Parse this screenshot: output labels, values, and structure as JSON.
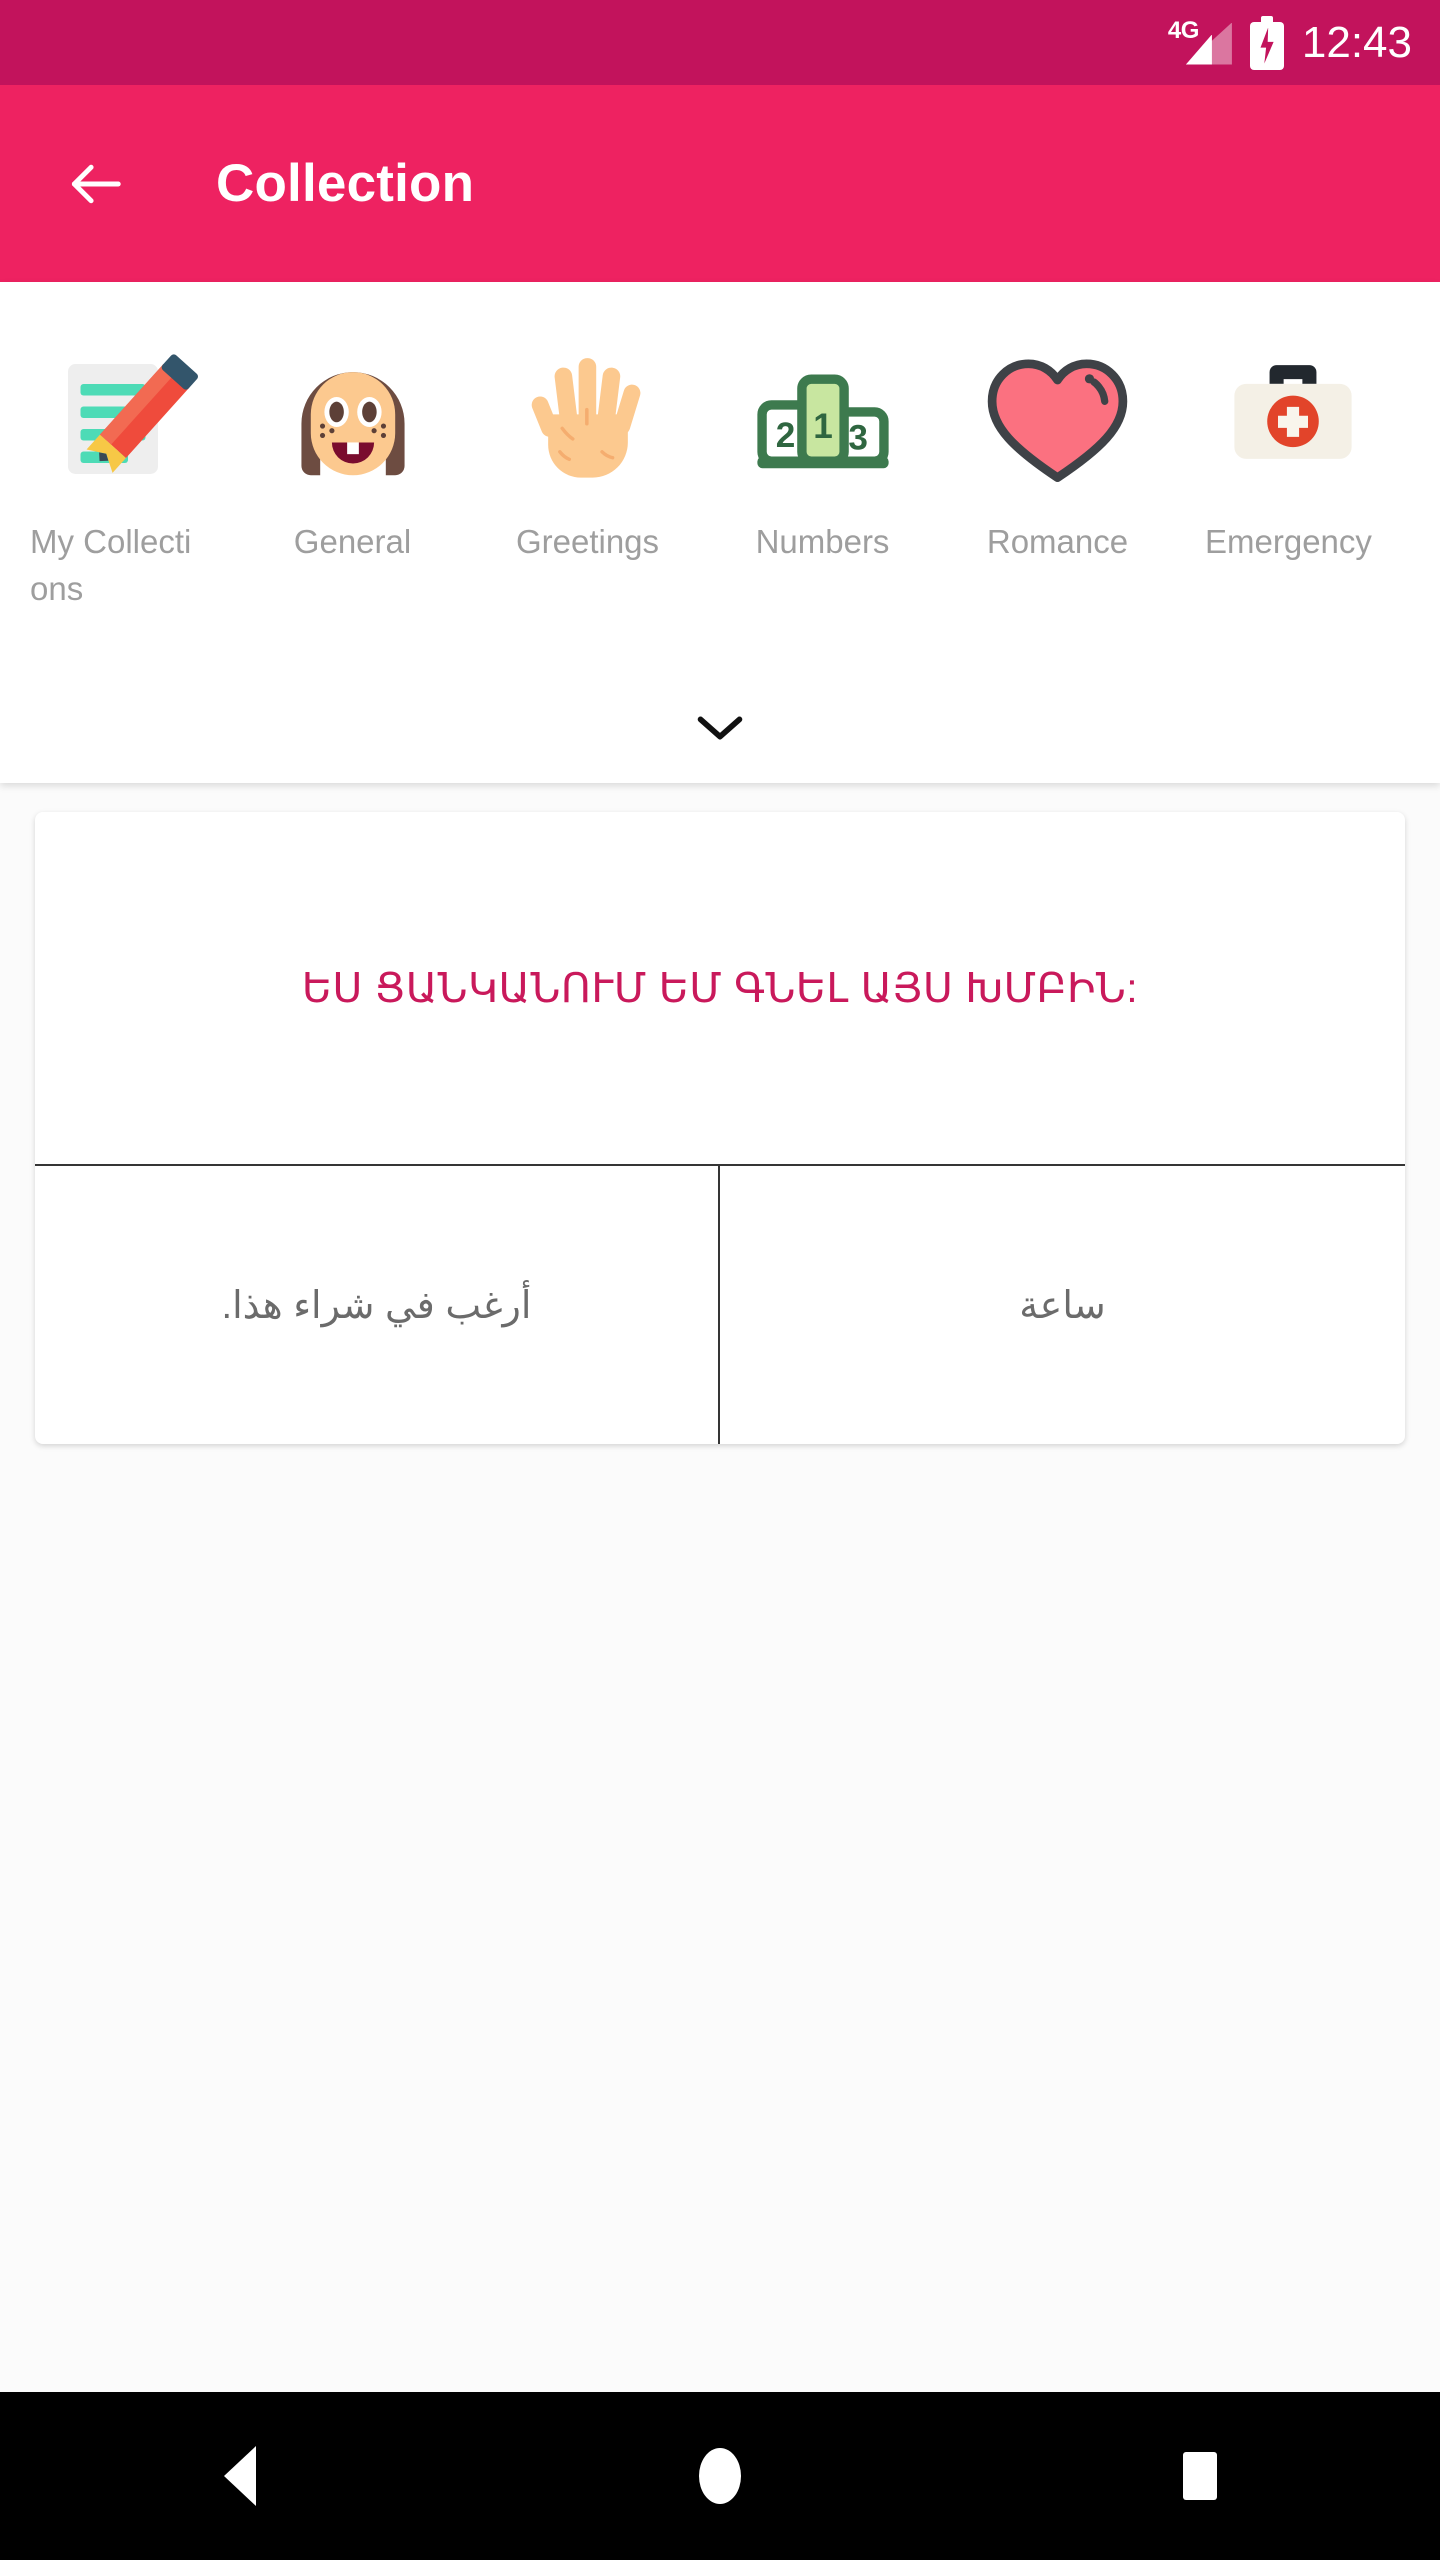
{
  "status_bar": {
    "network_type": "4G",
    "clock": "12:43",
    "signal_icon": "signal-bars-icon",
    "battery_icon": "battery-charging-icon",
    "background_color": "#c2135c"
  },
  "app_bar": {
    "back_icon": "back-arrow-icon",
    "title": "Collection",
    "background_color": "#ee2261",
    "text_color": "#ffffff"
  },
  "categories": {
    "expand_icon": "chevron-down-icon",
    "label_color": "#9e9e9e",
    "items": [
      {
        "label": "My Collections",
        "icon": "notepad-pencil-icon"
      },
      {
        "label": "General",
        "icon": "girl-face-icon"
      },
      {
        "label": "Greetings",
        "icon": "raised-hand-icon"
      },
      {
        "label": "Numbers",
        "icon": "podium-123-icon"
      },
      {
        "label": "Romance",
        "icon": "heart-icon"
      },
      {
        "label": "Emergency",
        "icon": "first-aid-kit-icon"
      }
    ]
  },
  "phrase_card": {
    "phrase": "ԵՍ ՑԱՆԿԱՆՈՒՄ ԵՄ ԳՆԵԼ ԱՅՍ ԽՄԲԻՆ:",
    "phrase_color": "#c9195b",
    "translation_left": "أرغب في شراء هذا.",
    "translation_right": "ساعة",
    "translation_color": "#6b6b6b"
  },
  "nav_bar": {
    "back_icon": "nav-back-triangle-icon",
    "home_icon": "nav-home-circle-icon",
    "recents_icon": "nav-recents-square-icon",
    "background_color": "#000000"
  }
}
